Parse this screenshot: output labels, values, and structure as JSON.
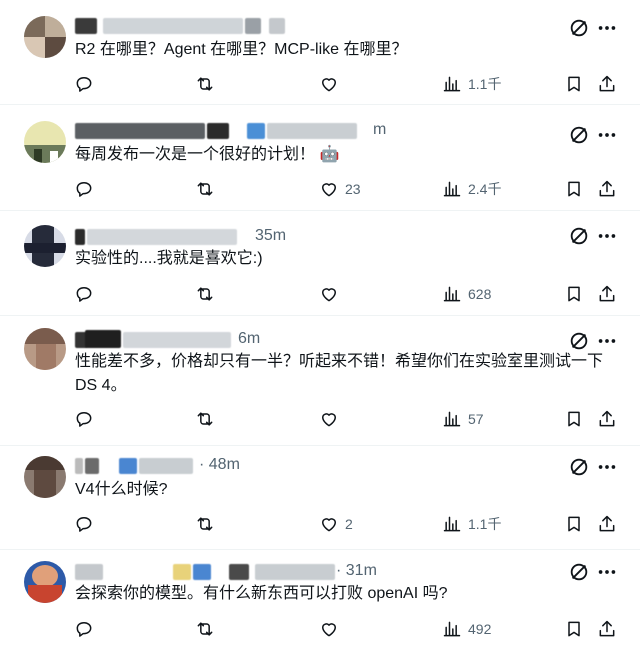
{
  "posts": [
    {
      "text": "R2 在哪里？Agent 在哪里？MCP-like 在哪里？",
      "time": "",
      "reply_count": "",
      "repost_count": "",
      "like_count": "",
      "views": "1.1千"
    },
    {
      "text": "每周发布一次是一个很好的计划！",
      "emoji": "🤖",
      "time": "m",
      "reply_count": "",
      "repost_count": "",
      "like_count": "23",
      "views": "2.4千"
    },
    {
      "text": "实验性的....我就是喜欢它:)",
      "time": "35m",
      "reply_count": "",
      "repost_count": "",
      "like_count": "",
      "views": "628"
    },
    {
      "text": "性能差不多，价格却只有一半？听起来不错！希望你们在实验室里测试一下",
      "text_line2": "DS 4。",
      "time": "6m",
      "reply_count": "",
      "repost_count": "",
      "like_count": "",
      "views": "57"
    },
    {
      "text": "V4什么时候?",
      "time": "· 48m",
      "reply_count": "",
      "repost_count": "",
      "like_count": "2",
      "views": "1.1千"
    },
    {
      "text": "会探索你的模型。有什么新东西可以打败 openAI 吗?",
      "time": "· 31m",
      "reply_count": "",
      "repost_count": "",
      "like_count": "",
      "views": "492"
    }
  ],
  "icons": {
    "reply": "reply-icon",
    "repost": "repost-icon",
    "like": "like-icon",
    "views": "views-icon",
    "bookmark": "bookmark-icon",
    "share": "share-icon",
    "grok": "grok-icon",
    "more": "more-icon"
  },
  "colors": {
    "text": "#0f1419",
    "muted": "#536471",
    "divider": "#eff3f4"
  }
}
